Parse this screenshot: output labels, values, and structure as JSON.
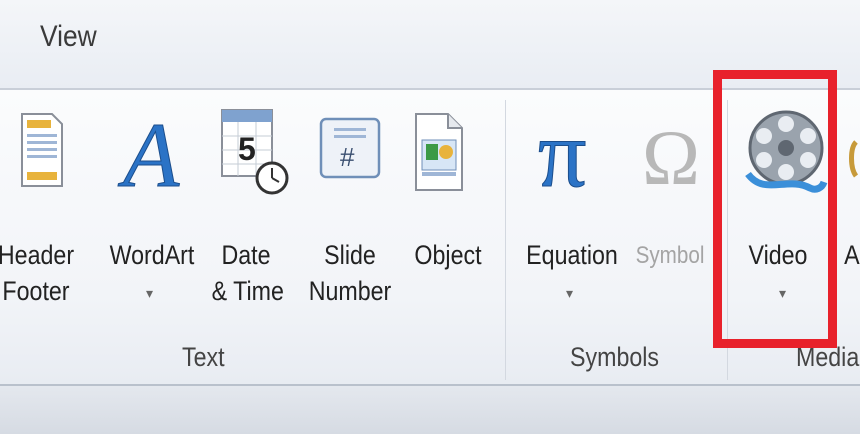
{
  "tabs": {
    "active": "View"
  },
  "groups": {
    "text": {
      "label": "Text",
      "items": [
        {
          "line1": "Header",
          "line2": "Footer",
          "icon": "header-footer-icon"
        },
        {
          "line1": "WordArt",
          "caret": "▾",
          "icon": "wordart-icon"
        },
        {
          "line1": "Date",
          "line2": "& Time",
          "icon": "date-time-icon"
        },
        {
          "line1": "Slide",
          "line2": "Number",
          "icon": "slide-number-icon"
        },
        {
          "line1": "Object",
          "icon": "object-icon"
        }
      ]
    },
    "symbols": {
      "label": "Symbols",
      "items": [
        {
          "line1": "Equation",
          "caret": "▾",
          "icon": "pi-icon"
        },
        {
          "line1": "Symbol",
          "disabled": true,
          "icon": "omega-icon"
        }
      ]
    },
    "media": {
      "label": "Media",
      "items": [
        {
          "line1": "Video",
          "caret": "▾",
          "icon": "film-reel-icon"
        },
        {
          "line1": "A",
          "icon": "audio-icon"
        }
      ]
    }
  },
  "colors": {
    "highlight": "#e8212b",
    "accent": "#2b73c6"
  }
}
